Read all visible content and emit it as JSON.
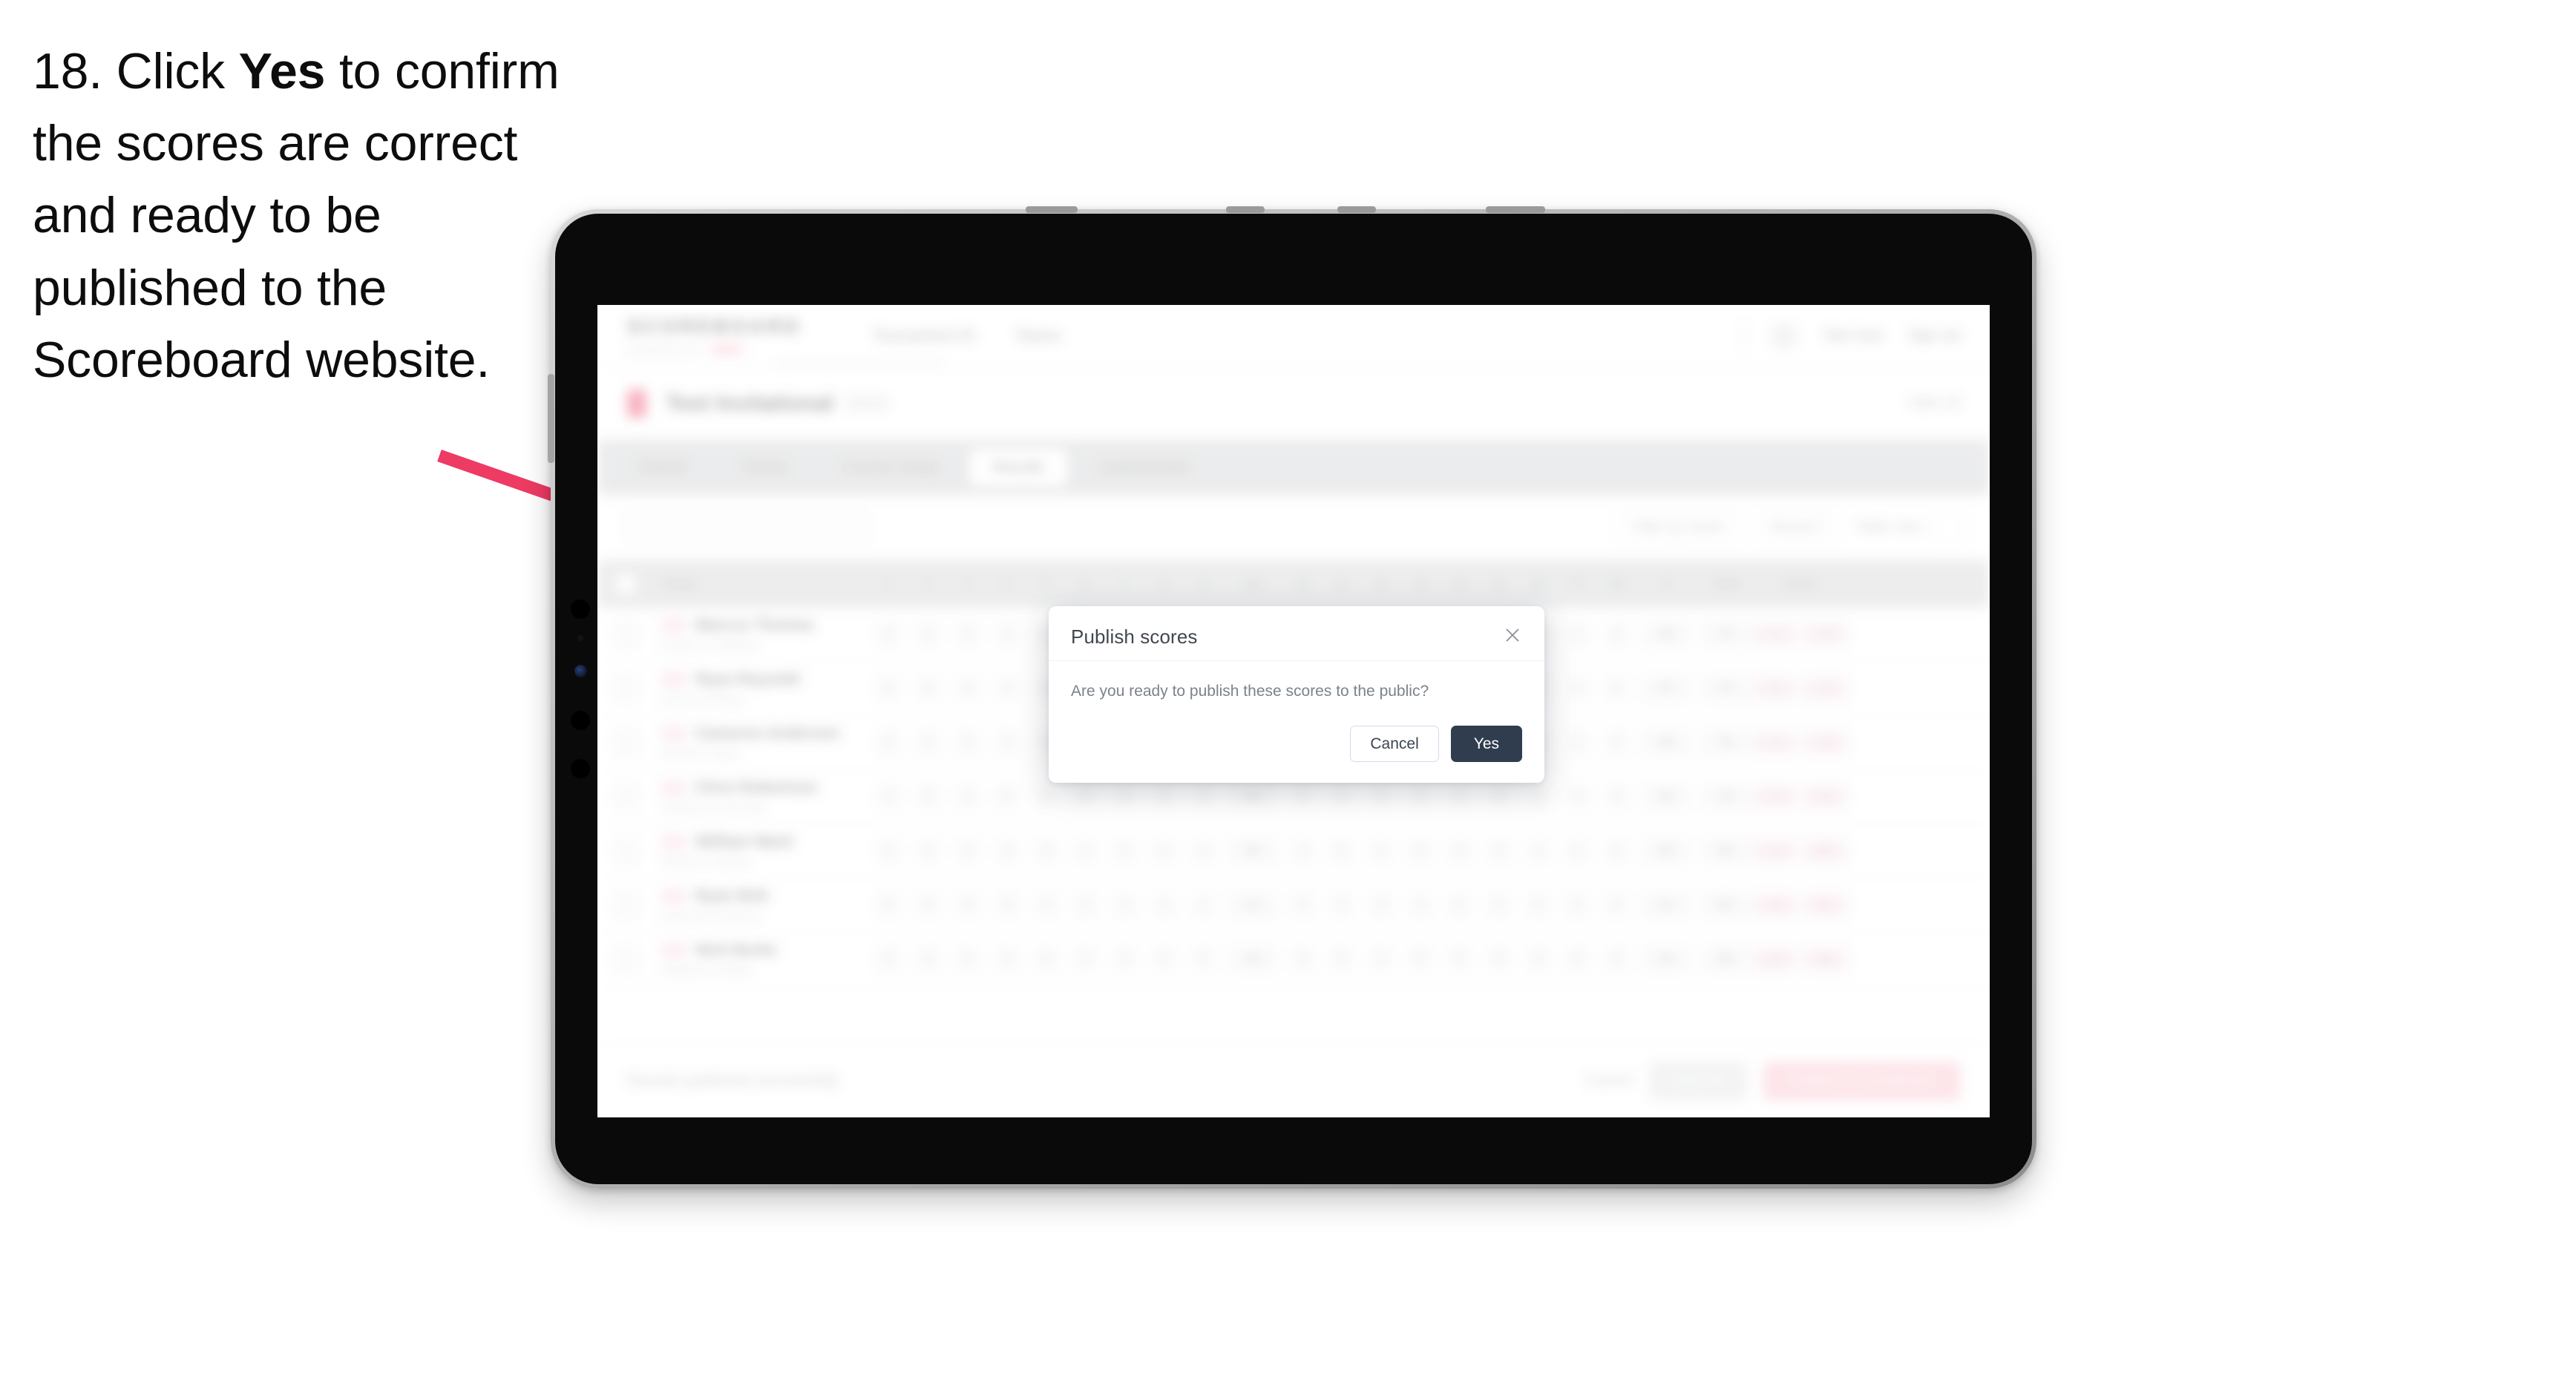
{
  "instruction": {
    "step_number": "18.",
    "text_before": "Click ",
    "emphasis": "Yes",
    "text_after": " to confirm the scores are correct and ready to be published to the Scoreboard website."
  },
  "annotation": {
    "arrow_color": "#ED3B63",
    "arrow_name": "pointer-arrow"
  },
  "device": {
    "type": "tablet",
    "bezel_color": "#0a0a0a",
    "frame_color": "#b5b5b5"
  },
  "app": {
    "header": {
      "logo": "SCOREBOARD",
      "logo_sub": "POWERED BY",
      "logo_pill": "GOLF",
      "nav": [
        {
          "label": "Tournament ID"
        },
        {
          "label": "Teams"
        }
      ],
      "right": [
        {
          "label": "Test User"
        },
        {
          "label": "Sign out"
        }
      ]
    },
    "event_bar": {
      "title": "Test Invitational",
      "subtitle": "2024",
      "right_label": "Hole 18"
    },
    "tabs": [
      {
        "label": "Details",
        "active": false
      },
      {
        "label": "Teams",
        "active": false
      },
      {
        "label": "Course Setup",
        "active": false
      },
      {
        "label": "Results",
        "active": true
      },
      {
        "label": "Leaderboard",
        "active": false
      }
    ],
    "filter_bar": {
      "search_placeholder": "Search",
      "controls": [
        {
          "label": "Filter by round"
        },
        {
          "label": "Round 1"
        },
        {
          "label": "Table view"
        }
      ]
    },
    "table": {
      "columns": [
        "Player",
        "1",
        "2",
        "3",
        "4",
        "5",
        "6",
        "7",
        "8",
        "9",
        "Out",
        "10",
        "11",
        "12",
        "13",
        "14",
        "15",
        "16",
        "17",
        "18",
        "In",
        "Total",
        "Score"
      ],
      "rows": [
        {
          "player": "Marcus Thomas",
          "sub": "Eastern Collegiate",
          "holes": [
            "4",
            "3",
            "5",
            "4",
            "4",
            "3",
            "5",
            "4",
            "4"
          ],
          "out": "36",
          "holes_in": [
            "4",
            "4",
            "5",
            "3",
            "4",
            "4",
            "5",
            "3",
            "4"
          ],
          "in": "36",
          "total": "72",
          "score": "E",
          "chips": [
            "+2",
            "72"
          ]
        },
        {
          "player": "Ryan Reynold",
          "sub": "Central College",
          "holes": [
            "5",
            "4",
            "4",
            "4",
            "3",
            "4",
            "5",
            "4",
            "4"
          ],
          "out": "37",
          "holes_in": [
            "4",
            "4",
            "4",
            "4",
            "5",
            "4",
            "4",
            "3",
            "5"
          ],
          "in": "37",
          "total": "74",
          "score": "+2",
          "chips": [
            "+2",
            "74"
          ]
        },
        {
          "player": "Cameron Anderson",
          "sub": "Northern State",
          "holes": [
            "4",
            "4",
            "5",
            "4",
            "4",
            "4",
            "4",
            "4",
            "5"
          ],
          "out": "38",
          "holes_in": [
            "4",
            "5",
            "4",
            "4",
            "4",
            "4",
            "5",
            "4",
            "4"
          ],
          "in": "38",
          "total": "76",
          "score": "+4",
          "chips": [
            "+4",
            "76"
          ]
        },
        {
          "player": "Chris Robertson",
          "sub": "Southern University",
          "holes": [
            "4",
            "5",
            "4",
            "5",
            "4",
            "4",
            "4",
            "5",
            "4"
          ],
          "out": "39",
          "holes_in": [
            "5",
            "4",
            "4",
            "4",
            "5",
            "4",
            "4",
            "4",
            "5"
          ],
          "in": "39",
          "total": "78",
          "score": "+6",
          "chips": [
            "+6",
            "78"
          ]
        },
        {
          "player": "William Ward",
          "sub": "Western Institute",
          "holes": [
            "5",
            "4",
            "5",
            "4",
            "5",
            "4",
            "5",
            "4",
            "4"
          ],
          "out": "40",
          "holes_in": [
            "4",
            "5",
            "4",
            "5",
            "4",
            "5",
            "4",
            "4",
            "5"
          ],
          "in": "40",
          "total": "80",
          "score": "+8",
          "chips": [
            "+8",
            "80"
          ]
        },
        {
          "player": "Ryan Brik",
          "sub": "Lakeside Academy",
          "holes": [
            "5",
            "5",
            "4",
            "5",
            "4",
            "5",
            "4",
            "5",
            "4"
          ],
          "out": "41",
          "holes_in": [
            "5",
            "4",
            "5",
            "4",
            "5",
            "5",
            "4",
            "5",
            "4"
          ],
          "in": "41",
          "total": "82",
          "score": "+10",
          "chips": [
            "+10",
            "82"
          ]
        },
        {
          "player": "Nick Burke",
          "sub": "Highland College",
          "holes": [
            "5",
            "5",
            "5",
            "4",
            "5",
            "4",
            "5",
            "5",
            "5"
          ],
          "out": "43",
          "holes_in": [
            "5",
            "5",
            "4",
            "5",
            "5",
            "4",
            "5",
            "5",
            "5"
          ],
          "in": "43",
          "total": "86",
          "score": "+14",
          "chips": [
            "+14",
            "86"
          ]
        }
      ]
    },
    "bottom_bar": {
      "note": "Results published successfully",
      "link_label": "Cancel",
      "secondary_button": "Save All",
      "primary_button": "Publish to Scoreboard"
    }
  },
  "dialog": {
    "title": "Publish scores",
    "message": "Are you ready to publish these scores to the public?",
    "cancel_label": "Cancel",
    "confirm_label": "Yes",
    "close_icon": "close-icon",
    "confirm_color": "#2F3D4F",
    "cancel_border_color": "#D3DCEB"
  }
}
